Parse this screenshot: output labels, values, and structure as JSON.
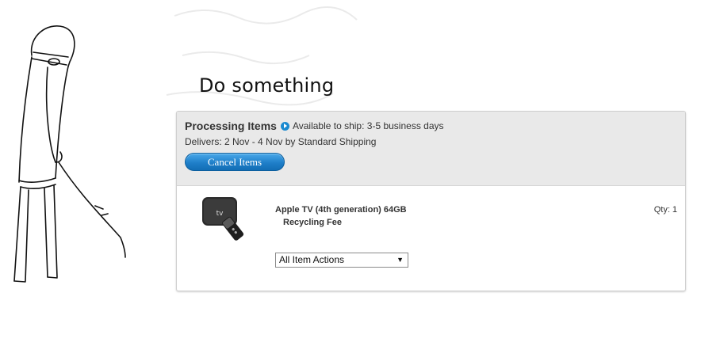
{
  "meme": {
    "caption": "Do something"
  },
  "order": {
    "status_title": "Processing Items",
    "ship_text": "Available to ship: 3-5 business days",
    "delivers_text": "Delivers: 2 Nov - 4 Nov by Standard Shipping",
    "cancel_label": "Cancel Items",
    "item": {
      "name": "Apple TV (4th generation) 64GB",
      "fee": "Recycling Fee",
      "qty_label": "Qty:",
      "qty_value": "1",
      "image_icon": "apple-tv-device-icon"
    },
    "actions_select": {
      "selected": "All Item Actions"
    }
  },
  "colors": {
    "accent_blue": "#1a8ad0",
    "header_bg": "#e9e9e9"
  }
}
